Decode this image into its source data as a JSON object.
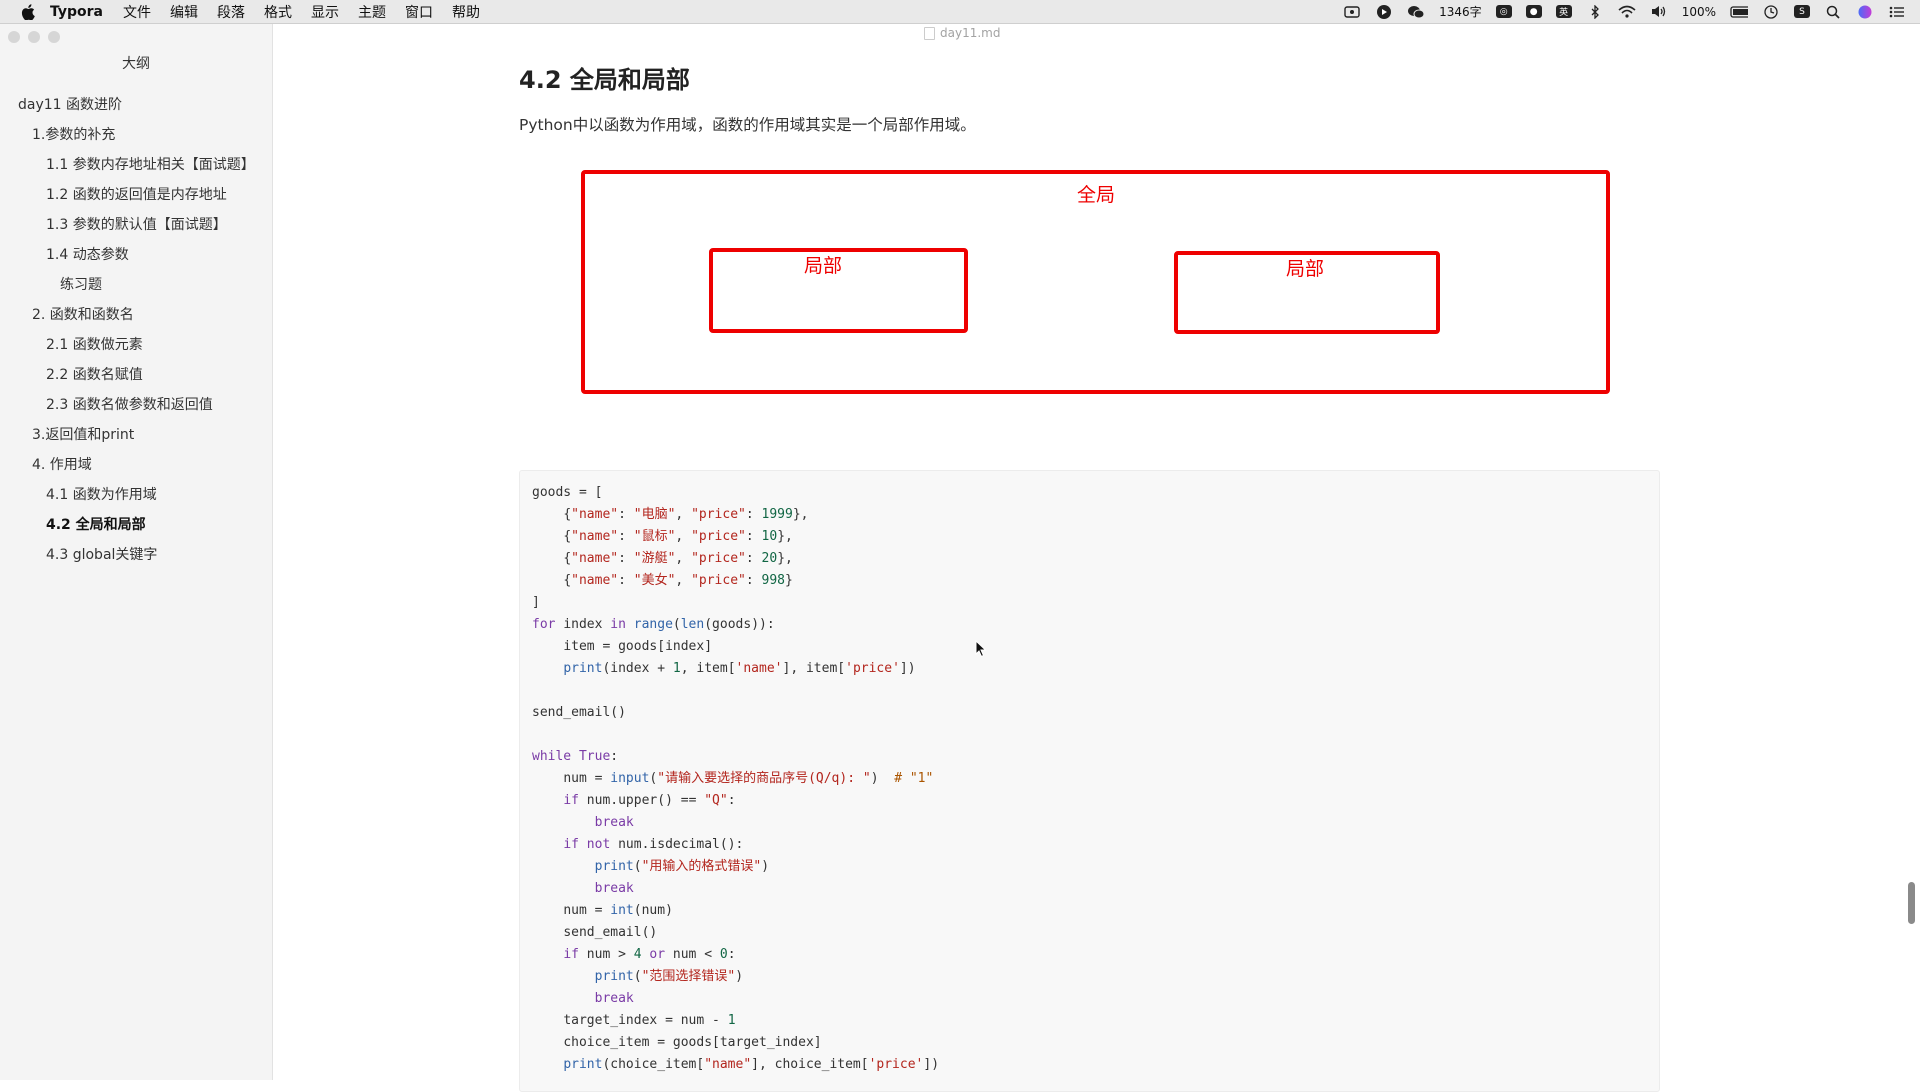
{
  "menubar": {
    "app_name": "Typora",
    "items": [
      "文件",
      "编辑",
      "段落",
      "格式",
      "显示",
      "主题",
      "窗口",
      "帮助"
    ],
    "word_count": "1346字",
    "battery": "100%",
    "input_method": "英"
  },
  "sidebar": {
    "title": "大纲",
    "items": [
      {
        "label": "day11 函数进阶",
        "level": 0
      },
      {
        "label": "1.参数的补充",
        "level": 1
      },
      {
        "label": "1.1 参数内存地址相关【面试题】",
        "level": 2
      },
      {
        "label": "1.2 函数的返回值是内存地址",
        "level": 2
      },
      {
        "label": "1.3 参数的默认值【面试题】",
        "level": 2
      },
      {
        "label": "1.4 动态参数",
        "level": 2
      },
      {
        "label": "练习题",
        "level": 3
      },
      {
        "label": "2. 函数和函数名",
        "level": 1
      },
      {
        "label": "2.1 函数做元素",
        "level": 2
      },
      {
        "label": "2.2 函数名赋值",
        "level": 2
      },
      {
        "label": "2.3 函数名做参数和返回值",
        "level": 2
      },
      {
        "label": "3.返回值和print",
        "level": 1
      },
      {
        "label": "4. 作用域",
        "level": 1
      },
      {
        "label": "4.1 函数为作用域",
        "level": 2
      },
      {
        "label": "4.2 全局和局部",
        "level": 2,
        "active": true
      },
      {
        "label": "4.3 global关键字",
        "level": 2
      }
    ]
  },
  "editor": {
    "file_name": "day11.md",
    "heading": "4.2 全局和局部",
    "paragraph": "Python中以函数为作用域，函数的作用域其实是一个局部作用域。",
    "diagram": {
      "global_label": "全局",
      "local_left_label": "局部",
      "local_right_label": "局部",
      "color": "#e00000"
    },
    "code_lines": [
      "goods = [",
      "    {\"name\": \"电脑\", \"price\": 1999},",
      "    {\"name\": \"鼠标\", \"price\": 10},",
      "    {\"name\": \"游艇\", \"price\": 20},",
      "    {\"name\": \"美女\", \"price\": 998}",
      "]",
      "for index in range(len(goods)):",
      "    item = goods[index]",
      "    print(index + 1, item['name'], item['price'])",
      "",
      "send_email()",
      "",
      "while True:",
      "    num = input(\"请输入要选择的商品序号(Q/q): \")  # \"1\"",
      "    if num.upper() == \"Q\":",
      "        break",
      "    if not num.isdecimal():",
      "        print(\"用输入的格式错误\")",
      "        break",
      "    num = int(num)",
      "    send_email()",
      "    if num > 4 or num < 0:",
      "        print(\"范围选择错误\")",
      "        break",
      "    target_index = num - 1",
      "    choice_item = goods[target_index]",
      "    print(choice_item[\"name\"], choice_item['price'])"
    ]
  }
}
